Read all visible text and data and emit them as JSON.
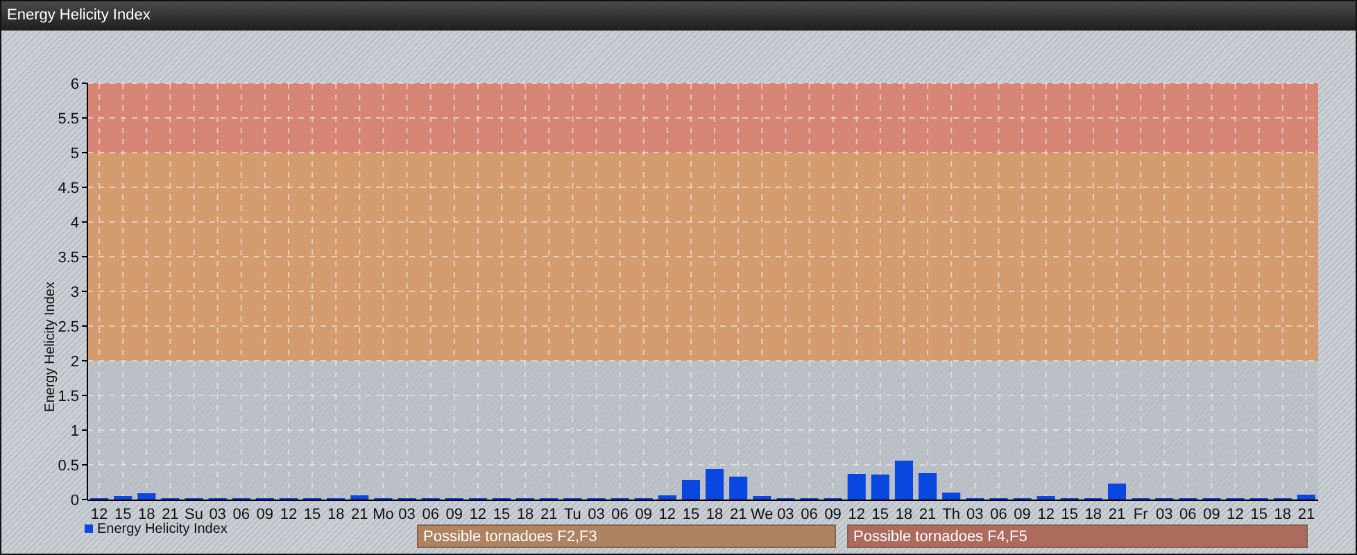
{
  "window": {
    "title": "Energy Helicity Index"
  },
  "chart": {
    "chart_data": {
      "type": "bar",
      "ylabel": "Energy Helicity Index",
      "ylim": [
        0,
        6
      ],
      "yticks": [
        0,
        0.5,
        1,
        1.5,
        2,
        2.5,
        3,
        3.5,
        4,
        4.5,
        5,
        5.5,
        6
      ],
      "categories": [
        "12",
        "15",
        "18",
        "21",
        "Su",
        "03",
        "06",
        "09",
        "12",
        "15",
        "18",
        "21",
        "Mo",
        "03",
        "06",
        "09",
        "12",
        "15",
        "18",
        "21",
        "Tu",
        "03",
        "06",
        "09",
        "12",
        "15",
        "18",
        "21",
        "We",
        "03",
        "06",
        "09",
        "12",
        "15",
        "18",
        "21",
        "Th",
        "03",
        "06",
        "09",
        "12",
        "15",
        "18",
        "21",
        "Fr",
        "03",
        "06",
        "09",
        "12",
        "15",
        "18",
        "21"
      ],
      "series": [
        {
          "name": "Energy Helicity Index",
          "color": "#0a46e0",
          "values": [
            0.02,
            0.05,
            0.09,
            0.02,
            0.02,
            0.02,
            0.02,
            0.02,
            0.02,
            0.02,
            0.02,
            0.06,
            0.02,
            0.02,
            0.02,
            0.02,
            0.02,
            0.02,
            0.02,
            0.02,
            0.02,
            0.02,
            0.02,
            0.02,
            0.06,
            0.28,
            0.44,
            0.33,
            0.05,
            0.02,
            0.02,
            0.02,
            0.37,
            0.36,
            0.56,
            0.38,
            0.1,
            0.02,
            0.02,
            0.02,
            0.05,
            0.02,
            0.02,
            0.23,
            0.02,
            0.02,
            0.02,
            0.02,
            0.02,
            0.02,
            0.02,
            0.07
          ]
        }
      ],
      "grid": true,
      "bands": [
        {
          "axis": "y",
          "from": 2,
          "to": 5,
          "color": "#d9955f"
        },
        {
          "axis": "y",
          "from": 5,
          "to": 6,
          "color": "#dc7a66"
        }
      ]
    },
    "zone_labels": [
      {
        "label": "Possible tornadoes F2,F3",
        "color": "#ad8362"
      },
      {
        "label": "Possible tornadoes F4,F5",
        "color": "#ad6b5e"
      }
    ]
  }
}
